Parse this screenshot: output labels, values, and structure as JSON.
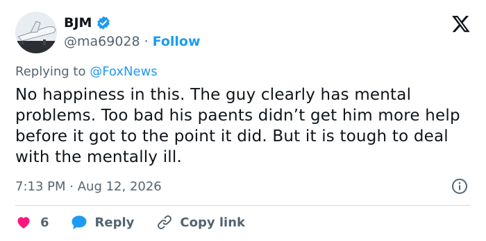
{
  "author": {
    "name": "BJM",
    "handle": "@ma69028",
    "separator": "·",
    "follow_label": "Follow",
    "avatar_icon": "space-shuttle-avatar",
    "verified": true
  },
  "platform_icon": "x-logo-icon",
  "reply_to": {
    "prefix": "Replying to",
    "mention": "@FoxNews"
  },
  "tweet": {
    "text": "No happiness in this. The guy clearly has mental problems. Too bad his paents didn’t get him more help before it got to the point it did. But it is tough to deal with the mentally ill."
  },
  "meta": {
    "time": "7:13 PM",
    "separator": "·",
    "date": "Aug 12, 2026"
  },
  "actions": {
    "like_count": "6",
    "reply_label": "Reply",
    "copy_label": "Copy link"
  },
  "colors": {
    "accent": "#1d9bf0",
    "like": "#f91880",
    "secondary_text": "#536471",
    "divider": "#cfd9de"
  }
}
